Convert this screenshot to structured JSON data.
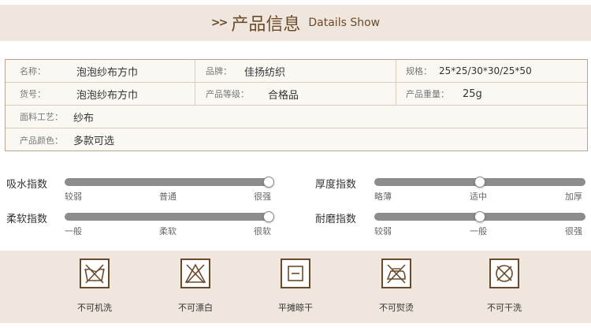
{
  "header": {
    "arrows": ">>",
    "title_cn": "产品信息",
    "title_en": "Datails  Show"
  },
  "specs": {
    "name_label": "名称：",
    "name_value": "泡泡纱布方巾",
    "brand_label": "品牌：",
    "brand_value": "佳扬纺织",
    "size_label": "规格：",
    "size_value": "25*25/30*30/25*50",
    "model_label": "货号：",
    "model_value": "泡泡纱布方巾",
    "grade_label": "产品等级：",
    "grade_value": "合格品",
    "weight_label": "产品重量：",
    "weight_value": "25g",
    "fabric_label": "面料工艺：",
    "fabric_value": "纱布",
    "color_label": "产品颜色：",
    "color_value": "多款可选"
  },
  "indices": [
    {
      "name": "吸水指数",
      "ticks": [
        "较弱",
        "普通",
        "很强"
      ],
      "level": 1.0
    },
    {
      "name": "厚度指数",
      "ticks": [
        "略薄",
        "适中",
        "加厚"
      ],
      "level": 0.5
    },
    {
      "name": "柔软指数",
      "ticks": [
        "一般",
        "柔软",
        "很软"
      ],
      "level": 1.0
    },
    {
      "name": "耐磨指数",
      "ticks": [
        "较弱",
        "一般",
        "很强"
      ],
      "level": 0.5
    }
  ],
  "care": [
    {
      "label": "不可机洗",
      "icon": "no-machine-wash-icon"
    },
    {
      "label": "不可漂白",
      "icon": "no-bleach-icon"
    },
    {
      "label": "平摊晾干",
      "icon": "dry-flat-icon"
    },
    {
      "label": "不可熨烫",
      "icon": "no-iron-icon"
    },
    {
      "label": "不可干洗",
      "icon": "no-dry-clean-icon"
    }
  ],
  "colors": {
    "accent": "#6b4a2b",
    "band": "#efe7dd",
    "track": "#8c8c8c"
  }
}
